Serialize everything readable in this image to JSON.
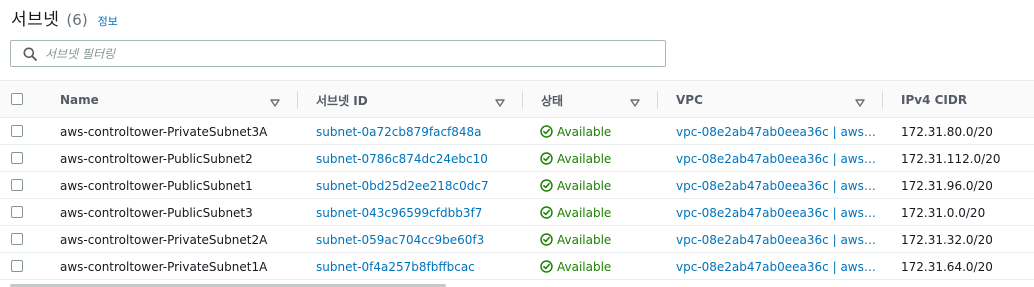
{
  "header": {
    "title": "서브넷",
    "count": "(6)",
    "info": "정보"
  },
  "search": {
    "placeholder": "서브넷 필터링"
  },
  "columns": {
    "name": "Name",
    "subnet_id": "서브넷 ID",
    "state": "상태",
    "vpc": "VPC",
    "cidr": "IPv4 CIDR"
  },
  "rows": [
    {
      "name": "aws-controltower-PrivateSubnet3A",
      "subnet_id": "subnet-0a72cb879facf848a",
      "state": "Available",
      "vpc": "vpc-08e2ab47ab0eea36c | aws…",
      "cidr": "172.31.80.0/20"
    },
    {
      "name": "aws-controltower-PublicSubnet2",
      "subnet_id": "subnet-0786c874dc24ebc10",
      "state": "Available",
      "vpc": "vpc-08e2ab47ab0eea36c | aws…",
      "cidr": "172.31.112.0/20"
    },
    {
      "name": "aws-controltower-PublicSubnet1",
      "subnet_id": "subnet-0bd25d2ee218c0dc7",
      "state": "Available",
      "vpc": "vpc-08e2ab47ab0eea36c | aws…",
      "cidr": "172.31.96.0/20"
    },
    {
      "name": "aws-controltower-PublicSubnet3",
      "subnet_id": "subnet-043c96599cfdbb3f7",
      "state": "Available",
      "vpc": "vpc-08e2ab47ab0eea36c | aws…",
      "cidr": "172.31.0.0/20"
    },
    {
      "name": "aws-controltower-PrivateSubnet2A",
      "subnet_id": "subnet-059ac704cc9be60f3",
      "state": "Available",
      "vpc": "vpc-08e2ab47ab0eea36c | aws…",
      "cidr": "172.31.32.0/20"
    },
    {
      "name": "aws-controltower-PrivateSubnet1A",
      "subnet_id": "subnet-0f4a257b8fbffbcac",
      "state": "Available",
      "vpc": "vpc-08e2ab47ab0eea36c | aws…",
      "cidr": "172.31.64.0/20"
    }
  ],
  "colors": {
    "link": "#0073bb",
    "available": "#1d8102",
    "header_bg": "#fafafa"
  },
  "icons": {
    "search": "search-icon",
    "sort": "sort-caret-icon",
    "status": "check-circle-icon"
  }
}
